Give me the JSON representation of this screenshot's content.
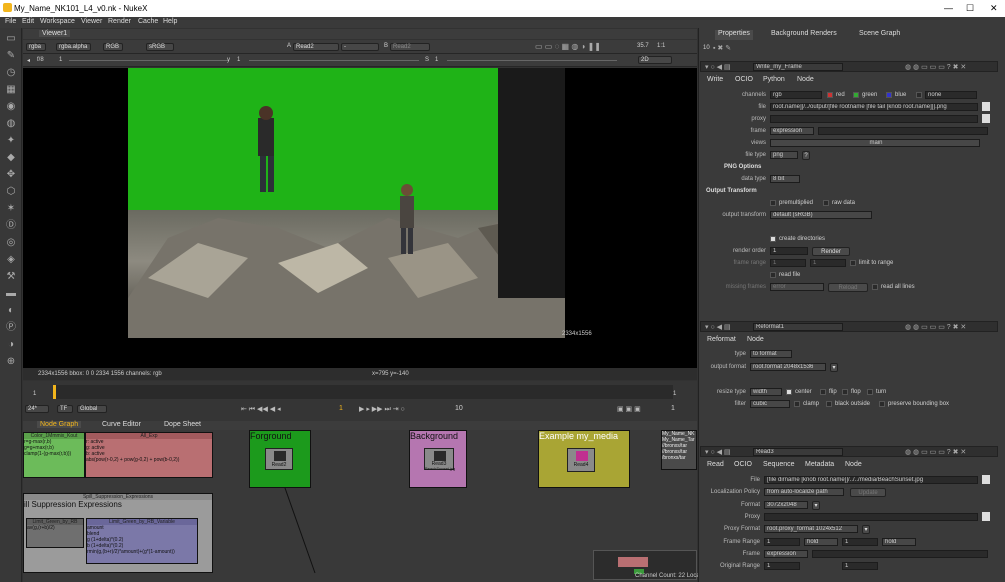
{
  "window": {
    "title": "My_Name_NK101_L4_v0.nk - NukeX",
    "min": "—",
    "max": "☐",
    "close": "✕"
  },
  "menu": [
    "File",
    "Edit",
    "Workspace",
    "Viewer",
    "Render",
    "Cache",
    "Help"
  ],
  "viewer": {
    "tab": "Viewer1",
    "channels": "rgba",
    "alpha": "rgba.alpha",
    "rgb": "RGB",
    "colorspace": "sRGB",
    "a_input": "A",
    "a_value": "Read2",
    "a_op": "-",
    "b_input": "B",
    "b_value": "Read2",
    "zoom": "35.7",
    "ratio": "1:1",
    "fstop_label": "f/8",
    "frame_val": "1",
    "y_label": "y",
    "y_val": "1",
    "s_label": "S",
    "s_val": "1",
    "view2d": "2D",
    "resolution": "2334x1556",
    "image_size": "2334x1556",
    "status_info": "2334x1556  bbox: 0 0 2334 1556 channels: rgb",
    "coords": "x=795 y=-140"
  },
  "timeline": {
    "fps": "24*",
    "tf": "TF",
    "global": "Global",
    "frame": "1",
    "step": "10",
    "end": "1"
  },
  "bottom_tabs": [
    "Node Graph",
    "Curve Editor",
    "Dope Sheet"
  ],
  "nodegraph": {
    "bd1_title": "Color_1Mmmix_Kout",
    "bd1_lines": [
      "r=g-max(r,b)",
      "g=g+max(r,b)",
      "clamp(1-(g-max(r,b)))"
    ],
    "bd2_title": "All_Exp",
    "bd2_lines": [
      "r: active",
      "g: active",
      "b: active",
      "abs(pow(r-0,2) + pow(g-0,2) + pow(b-0,2))"
    ],
    "bd3_title": "Spill_Suppression_Expressions",
    "bd3_heading": "ill Suppression Expressions",
    "bd4_title": "Limit_Green_by_RB",
    "bd4_lines": [
      "av(g,(r+b)/2)"
    ],
    "bd5_title": "Limit_Green_by_RB_Variable",
    "bd5_lines": [
      "amount",
      "blend",
      "",
      "g (1+delta)*(0.2)",
      "b (1+delta)*(0.2)",
      "",
      "rmin(g,(b+r)/2)*amount)+(g*(1-amount))"
    ],
    "fg_label": "Forground",
    "fg_node": "Read2",
    "bg_label": "Background",
    "bg_node": "Read3",
    "bg_file": "BeachSunset.jpg",
    "ex_label": "Example my_media",
    "ex_node": "Read4",
    "note_lines": [
      "My_Name_NK",
      "My_Name_Tar",
      "//bronxs/tar",
      "//bronxs/tar",
      "/bronxs/tar"
    ],
    "mini_node": "Write"
  },
  "status": "Channel Count: 22  Localization Mode: On  Memory: 1.0 GB (0.8%)  CPU: 0.0%  Disk: 0.1 MB/s  Network: 0.0 MB/s",
  "props": {
    "tabs": [
      "Properties",
      "Background Renders",
      "Scene Graph"
    ],
    "count": "10",
    "write": {
      "name": "Write_my_Frame",
      "tabs": [
        "Write",
        "OCIO",
        "Python",
        "Node"
      ],
      "channels_lbl": "channels",
      "channels": "rgb",
      "red": "red",
      "green": "green",
      "blue": "blue",
      "none": "none",
      "file_lbl": "file",
      "file": "root.name]]/../output/[file rootname [file tail [knob root.name]]].png",
      "proxy_lbl": "proxy",
      "frame_lbl": "frame",
      "frame": "expression",
      "views_lbl": "views",
      "views": "main",
      "filetype_lbl": "file type",
      "filetype": "png",
      "png_opts": "PNG Options",
      "datatype_lbl": "data type",
      "datatype": "8 bit",
      "output_transform": "Output Transform",
      "premult": "premultiplied",
      "rawdata": "raw data",
      "ot_lbl": "output transform",
      "ot": "default (sRGB)",
      "createdir": "create directories",
      "renderorder_lbl": "render order",
      "renderorder": "1",
      "render_btn": "Render",
      "framerange_lbl": "frame range",
      "fr1": "1",
      "fr2": "1",
      "limit": "limit to range",
      "readfile": "read file",
      "missing_lbl": "missing frames",
      "missing": "error",
      "reload": "Reload",
      "readall": "read all lines"
    },
    "reformat": {
      "name": "Reformat1",
      "tabs": [
        "Reformat",
        "Node"
      ],
      "type_lbl": "type",
      "type": "to format",
      "outfmt_lbl": "output format",
      "outfmt": "root.format 2048x1536",
      "resize_lbl": "resize type",
      "resize": "width",
      "center": "center",
      "flip": "flip",
      "flop": "flop",
      "turn": "turn",
      "filter_lbl": "filter",
      "filter": "cubic",
      "clamp": "clamp",
      "blackout": "black outside",
      "pbb": "preserve bounding box"
    },
    "read": {
      "name": "Read3",
      "tabs": [
        "Read",
        "OCIO",
        "Sequence",
        "Metadata",
        "Node"
      ],
      "file_lbl": "File",
      "file": "[file dirname [knob root.name]]/../../media/BeachSunset.jpg",
      "loc_lbl": "Localization Policy",
      "loc": "from auto-localize path",
      "update": "Update",
      "format_lbl": "Format",
      "format": "3072x2048",
      "proxy_lbl": "Proxy",
      "pformat_lbl": "Proxy Format",
      "pformat": "root.proxy_format 1024x512",
      "frange_lbl": "Frame Range",
      "fr1": "1",
      "hold": "hold",
      "fr2": "1",
      "hold2": "hold",
      "frame_lbl": "Frame",
      "frame": "expression",
      "orange_lbl": "Original Range",
      "or1": "1",
      "or2": "1"
    }
  }
}
